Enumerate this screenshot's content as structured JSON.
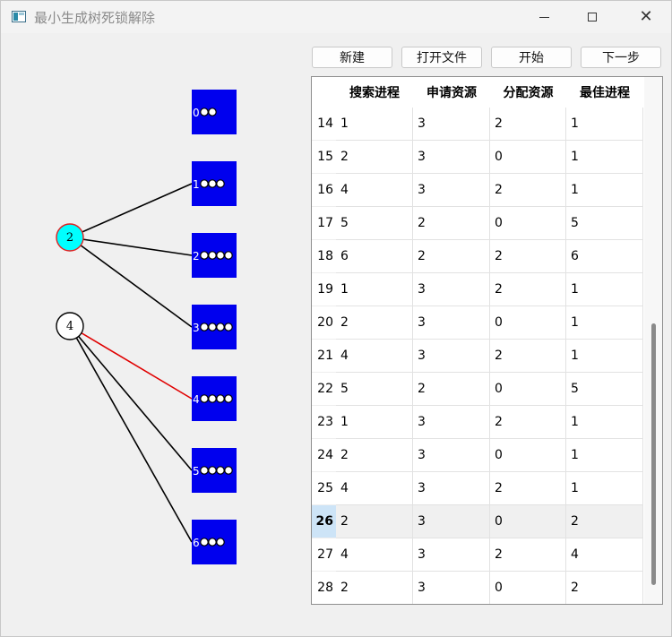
{
  "window": {
    "title": "最小生成树死锁解除",
    "min_glyph": "—",
    "max_glyph": "☐",
    "close_glyph": "✕"
  },
  "toolbar": {
    "new_label": "新建",
    "open_file_label": "打开文件",
    "start_label": "开始",
    "next_step_label": "下一步"
  },
  "graph": {
    "process_nodes": [
      {
        "label": "2",
        "state": "highlighted",
        "fill": "#00ffff",
        "stroke": "#e02020"
      },
      {
        "label": "4",
        "state": "normal",
        "fill": "#ffffff",
        "stroke": "#000000"
      }
    ],
    "resource_nodes": [
      {
        "label": "0",
        "units": 2
      },
      {
        "label": "1",
        "units": 3
      },
      {
        "label": "2",
        "units": 4
      },
      {
        "label": "3",
        "units": 4
      },
      {
        "label": "4",
        "units": 4
      },
      {
        "label": "5",
        "units": 4
      },
      {
        "label": "6",
        "units": 3
      }
    ],
    "edges": [
      {
        "from": "2",
        "to": "1",
        "color": "#000000"
      },
      {
        "from": "2",
        "to": "2",
        "color": "#000000"
      },
      {
        "from": "2",
        "to": "3",
        "color": "#000000"
      },
      {
        "from": "4",
        "to": "4",
        "color": "#e00000"
      },
      {
        "from": "4",
        "to": "5",
        "color": "#000000"
      },
      {
        "from": "4",
        "to": "6",
        "color": "#000000"
      }
    ],
    "resource_color": "#0000ee"
  },
  "table": {
    "columns": [
      "搜索进程",
      "申请资源",
      "分配资源",
      "最佳进程"
    ],
    "current_row": "26",
    "rows": [
      {
        "n": "14",
        "cells": [
          "1",
          "3",
          "2",
          "1"
        ]
      },
      {
        "n": "15",
        "cells": [
          "2",
          "3",
          "0",
          "1"
        ]
      },
      {
        "n": "16",
        "cells": [
          "4",
          "3",
          "2",
          "1"
        ]
      },
      {
        "n": "17",
        "cells": [
          "5",
          "2",
          "0",
          "5"
        ]
      },
      {
        "n": "18",
        "cells": [
          "6",
          "2",
          "2",
          "6"
        ]
      },
      {
        "n": "19",
        "cells": [
          "1",
          "3",
          "2",
          "1"
        ]
      },
      {
        "n": "20",
        "cells": [
          "2",
          "3",
          "0",
          "1"
        ]
      },
      {
        "n": "21",
        "cells": [
          "4",
          "3",
          "2",
          "1"
        ]
      },
      {
        "n": "22",
        "cells": [
          "5",
          "2",
          "0",
          "5"
        ]
      },
      {
        "n": "23",
        "cells": [
          "1",
          "3",
          "2",
          "1"
        ]
      },
      {
        "n": "24",
        "cells": [
          "2",
          "3",
          "0",
          "1"
        ]
      },
      {
        "n": "25",
        "cells": [
          "4",
          "3",
          "2",
          "1"
        ]
      },
      {
        "n": "26",
        "cells": [
          "2",
          "3",
          "0",
          "2"
        ]
      },
      {
        "n": "27",
        "cells": [
          "4",
          "3",
          "2",
          "4"
        ]
      },
      {
        "n": "28",
        "cells": [
          "2",
          "3",
          "0",
          "2"
        ]
      }
    ]
  }
}
